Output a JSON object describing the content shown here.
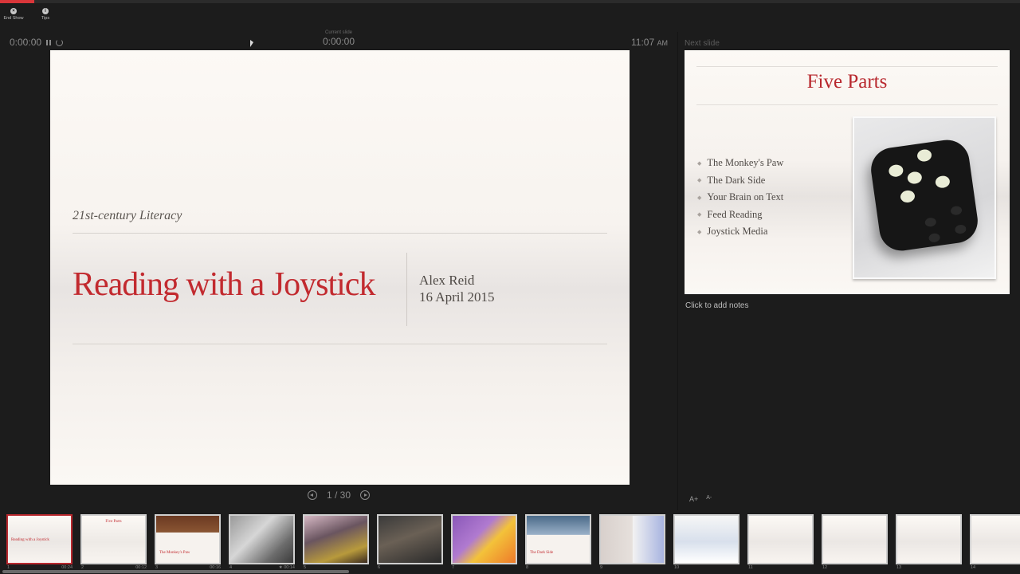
{
  "progress": {
    "current_slide": 1,
    "total_slides": 30,
    "fraction": 0.0333,
    "color": "#d9363a"
  },
  "toolbar": {
    "end_show_label": "End Show",
    "tips_label": "Tips"
  },
  "timers": {
    "elapsed": "0:00:00",
    "current_slide_label": "Current slide",
    "current_slide_time": "0:00:00",
    "clock_time": "11:07",
    "clock_ampm": "AM"
  },
  "current_slide": {
    "subtitle": "21st-century Literacy",
    "title": "Reading with a Joystick",
    "author": "Alex Reid",
    "date": "16 April 2015",
    "title_color": "#c22a2f"
  },
  "navigation": {
    "counter": "1 / 30"
  },
  "next_slide": {
    "label": "Next slide",
    "title": "Five Parts",
    "bullets": [
      "The Monkey's Paw",
      "The Dark Side",
      "Your Brain on Text",
      "Feed Reading",
      "Joystick Media"
    ],
    "image": "black-die-photo"
  },
  "notes": {
    "placeholder": "Click to add notes"
  },
  "font_controls": {
    "increase": "A+",
    "decrease": "A-"
  },
  "thumbnails": [
    {
      "number": "1",
      "time": "00:24",
      "active": true,
      "label": "Reading with a Joystick"
    },
    {
      "number": "2",
      "time": "00:12",
      "label": "Five Parts"
    },
    {
      "number": "3",
      "time": "00:16",
      "label": "The Monkey's Paw"
    },
    {
      "number": "4",
      "time": "★ 00:14",
      "label": ""
    },
    {
      "number": "5",
      "time": "",
      "label": ""
    },
    {
      "number": "6",
      "time": "",
      "label": ""
    },
    {
      "number": "7",
      "time": "",
      "label": ""
    },
    {
      "number": "8",
      "time": "",
      "label": "The Dark Side"
    },
    {
      "number": "9",
      "time": "",
      "label": ""
    },
    {
      "number": "10",
      "time": "",
      "label": ""
    },
    {
      "number": "11",
      "time": "",
      "label": ""
    },
    {
      "number": "12",
      "time": "",
      "label": ""
    },
    {
      "number": "13",
      "time": "",
      "label": ""
    },
    {
      "number": "14",
      "time": "",
      "label": ""
    }
  ]
}
